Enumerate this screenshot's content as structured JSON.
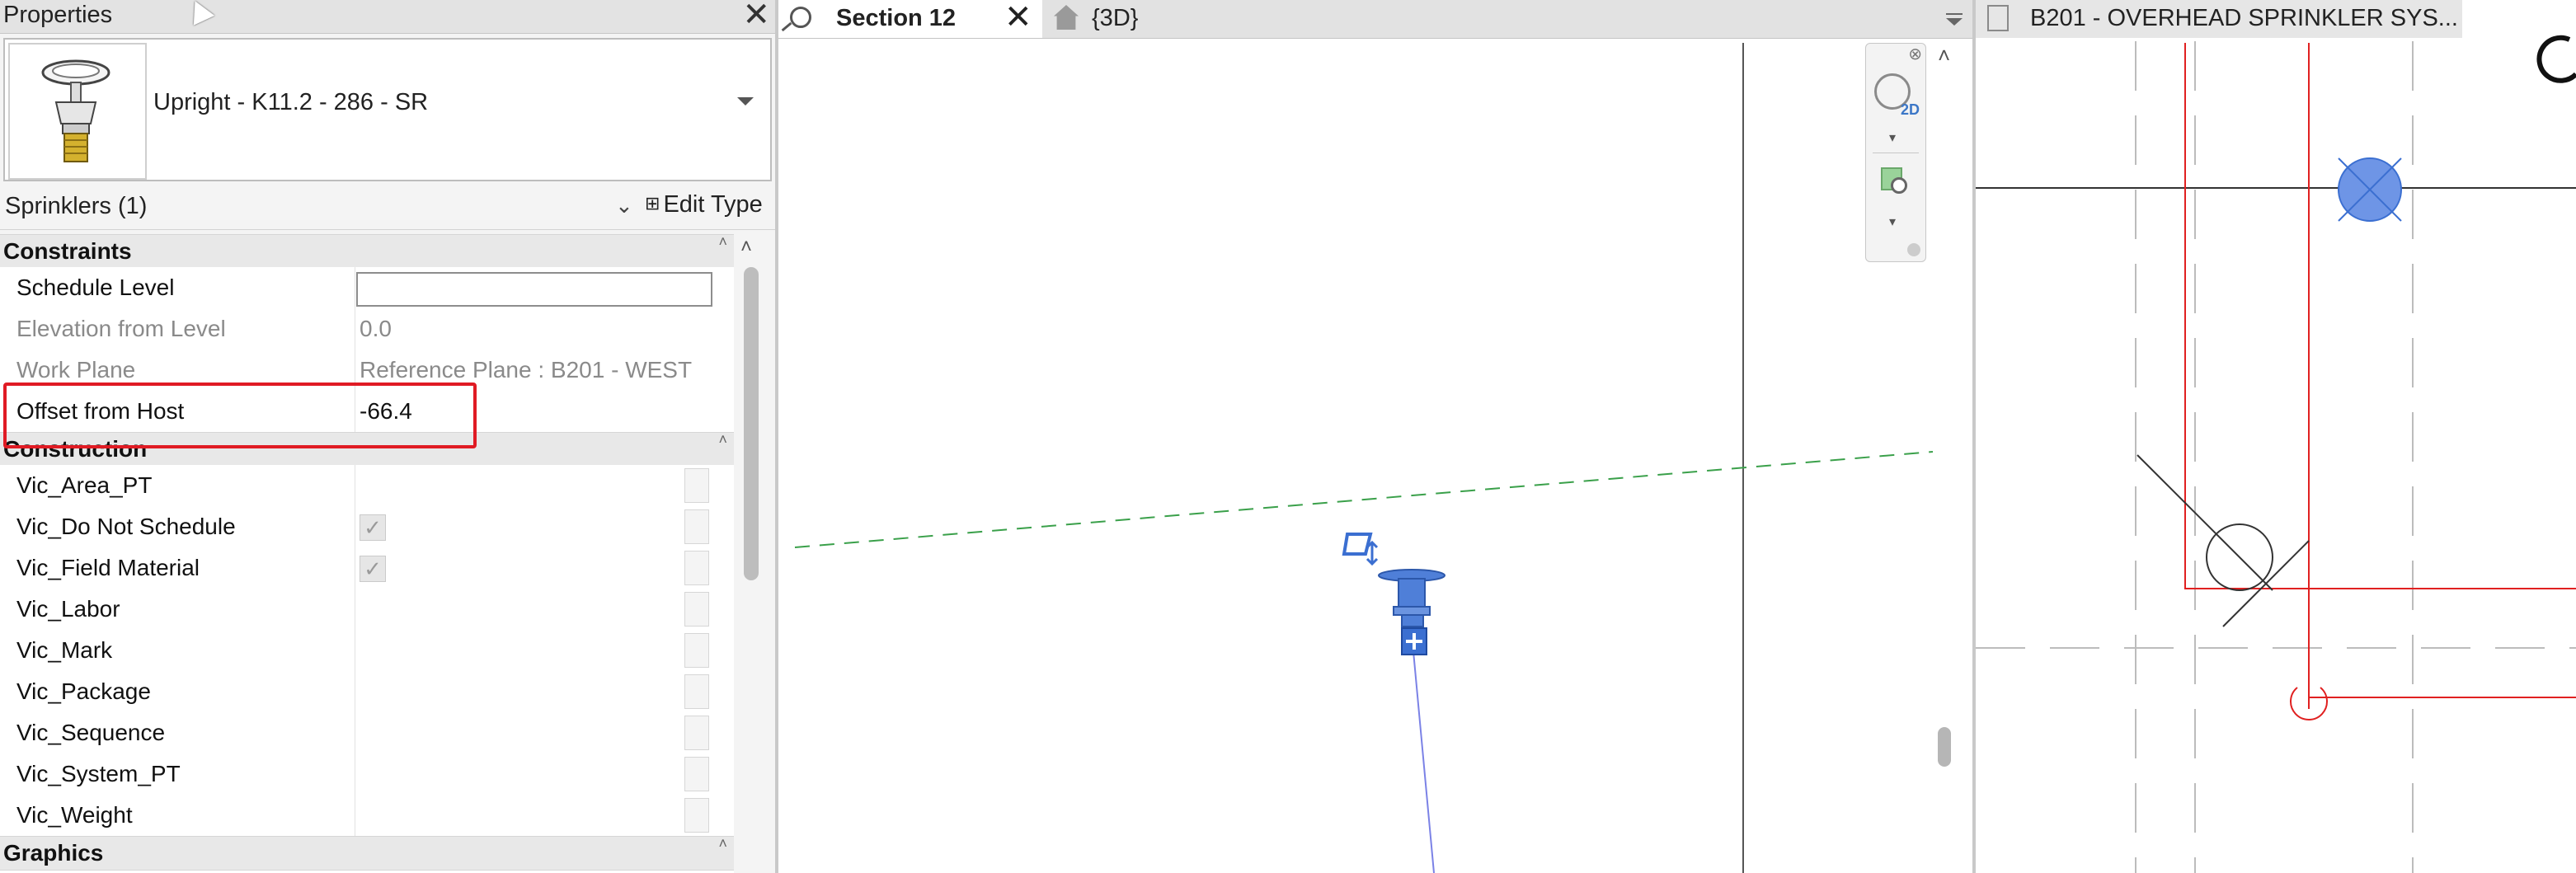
{
  "properties": {
    "title": "Properties",
    "type_name": "Upright - K11.2 - 286 - SR",
    "filter_label": "Sprinklers (1)",
    "edit_type_label": "Edit Type",
    "groups": {
      "constraints": "Constraints",
      "construction": "Construction",
      "graphics": "Graphics"
    },
    "constraints": [
      {
        "name": "Schedule Level",
        "value": ""
      },
      {
        "name": "Elevation from Level",
        "value": "0.0"
      },
      {
        "name": "Work Plane",
        "value": "Reference Plane : B201 - WEST"
      },
      {
        "name": "Offset from Host",
        "value": "-66.4"
      }
    ],
    "construction": [
      {
        "name": "Vic_Area_PT"
      },
      {
        "name": "Vic_Do Not Schedule",
        "checked": true
      },
      {
        "name": "Vic_Field Material",
        "checked": true
      },
      {
        "name": "Vic_Labor"
      },
      {
        "name": "Vic_Mark"
      },
      {
        "name": "Vic_Package"
      },
      {
        "name": "Vic_Sequence"
      },
      {
        "name": "Vic_System_PT"
      },
      {
        "name": "Vic_Weight"
      }
    ]
  },
  "views": {
    "section_tab": "Section 12",
    "threed_tab": "{3D}",
    "navbar_2d_label": "2D",
    "plan_tab": "B201 - OVERHEAD SPRINKLER SYS..."
  },
  "colors": {
    "highlight": "#e01b24",
    "selection_blue": "#3b6fd1",
    "level_line": "#3aa04a",
    "red_line": "#e02020"
  }
}
